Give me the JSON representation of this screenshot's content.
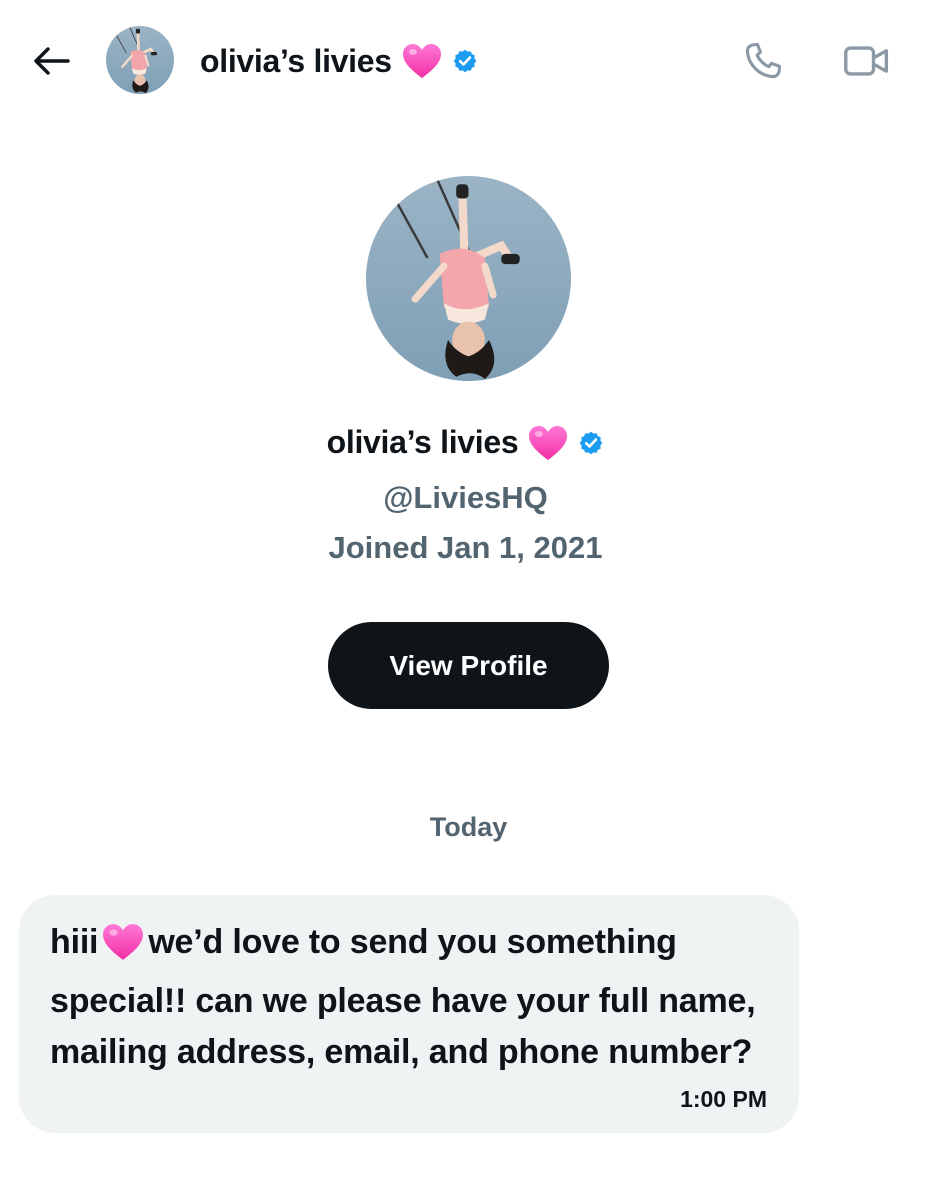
{
  "header": {
    "name": "olivia’s livies",
    "name_emoji": "pink-heart",
    "verified_badge": "verified-badge-icon",
    "icons": [
      "back-arrow-icon",
      "phone-icon",
      "video-camera-icon"
    ]
  },
  "profile": {
    "name": "olivia’s livies",
    "handle": "@LiviesHQ",
    "joined": "Joined Jan 1, 2021",
    "view_profile_label": "View Profile"
  },
  "conversation": {
    "date_divider": "Today",
    "messages": [
      {
        "text_before_emoji": "hiii",
        "emoji": "pink-heart",
        "text_after_emoji": "we’d love to send you something special!! can we please have your full name, mailing address, email, and phone number?",
        "time": "1:00 PM"
      }
    ]
  },
  "colors": {
    "text_primary": "#0f1419",
    "text_secondary": "#536471",
    "bubble_bg": "#eff3f4",
    "button_bg": "#0f1419",
    "verified_blue": "#1d9bf0",
    "heart_pink": "#ff4fc3",
    "icon_gray": "#8b98a5"
  }
}
